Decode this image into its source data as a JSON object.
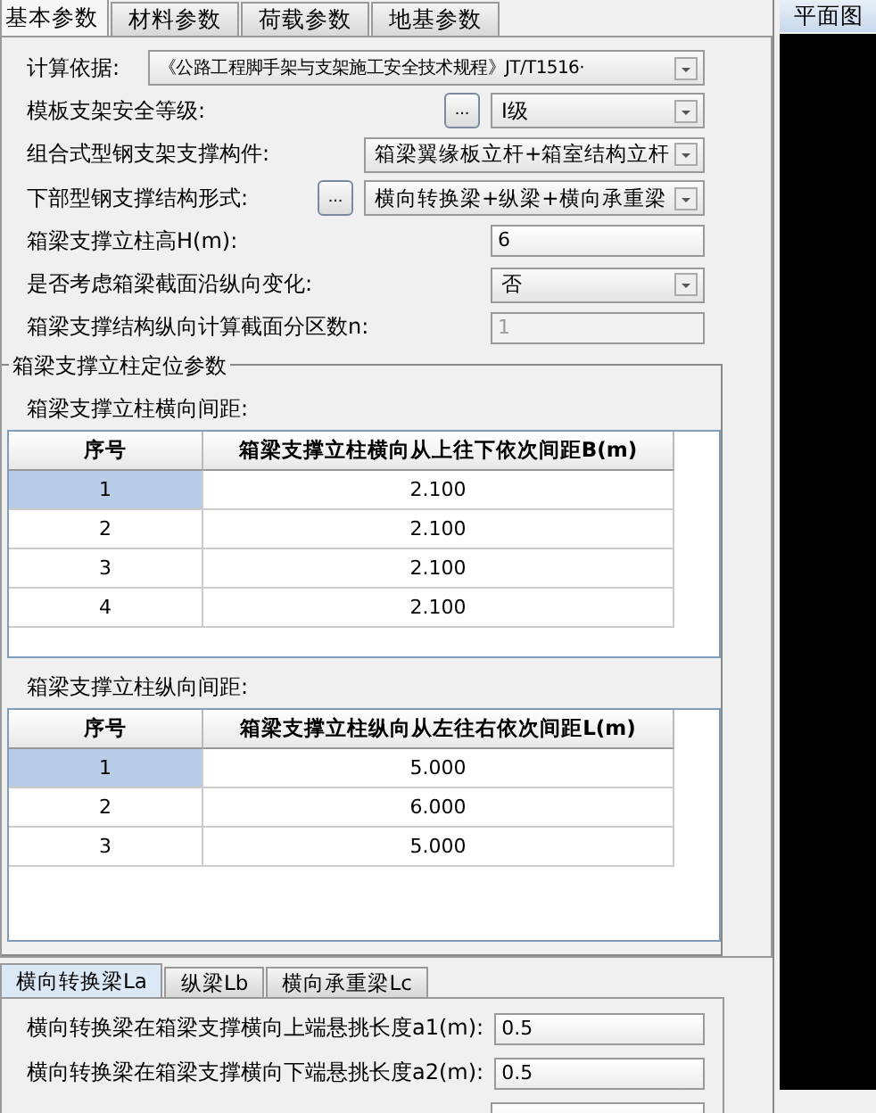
{
  "tabs": [
    {
      "label": "基本参数",
      "selected": true
    },
    {
      "label": "材料参数",
      "selected": false
    },
    {
      "label": "荷载参数",
      "selected": false
    },
    {
      "label": "地基参数",
      "selected": false
    }
  ],
  "fields": [
    {
      "label": "计算依据:",
      "kind": "select",
      "value": "《公路工程脚手架与支架施工安全技术规程》JT/T1516·"
    },
    {
      "label": "模板支架安全等级:",
      "kind": "select",
      "value": "I级",
      "button": "..."
    },
    {
      "label": "组合式型钢支架支撑构件:",
      "kind": "select",
      "value": "箱梁翼缘板立杆+箱室结构立杆"
    },
    {
      "label": "下部型钢支撑结构形式:",
      "kind": "select",
      "value": "横向转换梁+纵梁+横向承重梁",
      "button": "..."
    },
    {
      "label": "箱梁支撑立柱高H(m):",
      "kind": "text",
      "value": "6",
      "disabled": false
    },
    {
      "label": "是否考虑箱梁截面沿纵向变化:",
      "kind": "select",
      "value": "否"
    },
    {
      "label": "箱梁支撑结构纵向计算截面分区数n:",
      "kind": "text",
      "value": "1",
      "disabled": true
    }
  ],
  "group": {
    "title": "箱梁支撑立柱定位参数",
    "tables": [
      {
        "label": "箱梁支撑立柱横向间距:",
        "columns": [
          "序号",
          "箱梁支撑立柱横向从上往下依次间距B(m)"
        ],
        "rows": [
          {
            "cells": [
              "1",
              "2.100"
            ],
            "selected": true
          },
          {
            "cells": [
              "2",
              "2.100"
            ],
            "selected": false
          },
          {
            "cells": [
              "3",
              "2.100"
            ],
            "selected": false
          },
          {
            "cells": [
              "4",
              "2.100"
            ],
            "selected": false
          }
        ]
      },
      {
        "label": "箱梁支撑立柱纵向间距:",
        "columns": [
          "序号",
          "箱梁支撑立柱纵向从左往右依次间距L(m)"
        ],
        "rows": [
          {
            "cells": [
              "1",
              "5.000"
            ],
            "selected": true
          },
          {
            "cells": [
              "2",
              "6.000"
            ],
            "selected": false
          },
          {
            "cells": [
              "3",
              "5.000"
            ],
            "selected": false
          }
        ]
      }
    ]
  },
  "bottom_tabs": [
    {
      "label": "横向转换梁La",
      "selected": true
    },
    {
      "label": "纵梁Lb",
      "selected": false
    },
    {
      "label": "横向承重梁Lc",
      "selected": false
    }
  ],
  "bottom_fields": [
    {
      "label": "横向转换梁在箱梁支撑横向上端悬挑长度a1(m):",
      "value": "0.5"
    },
    {
      "label": "横向转换梁在箱梁支撑横向下端悬挑长度a2(m):",
      "value": "0.5"
    }
  ],
  "plan_tab": {
    "label": "平面图"
  }
}
